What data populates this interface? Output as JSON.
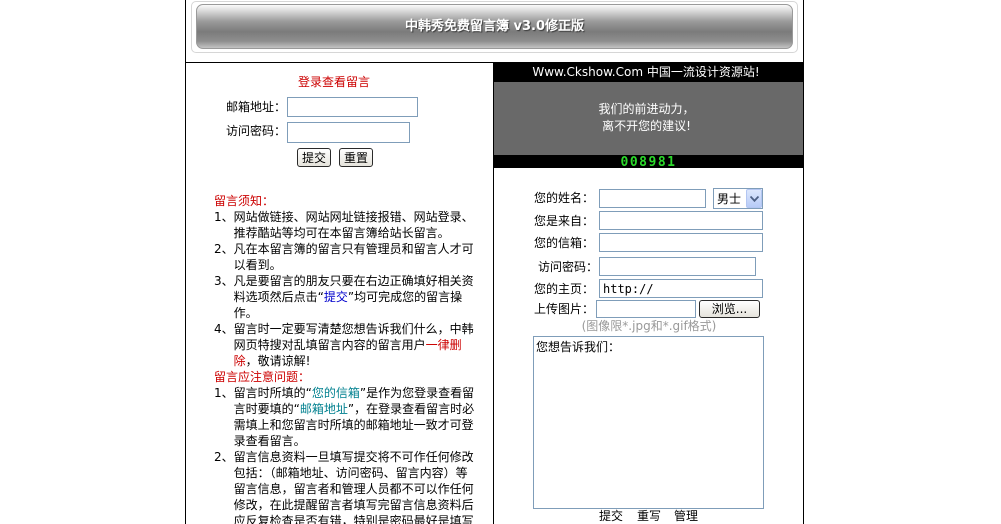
{
  "page": {
    "banner_title": "中韩秀免费留言簿 v3.0修正版"
  },
  "colors": {
    "red": "#cc0000",
    "blue": "#0000cc",
    "teal": "#00808f",
    "hint_gray": "#999999",
    "panel_gray": "#696969",
    "counter_green": "#2bd92b"
  },
  "login": {
    "heading": "登录查看留言",
    "email_label": "邮箱地址：",
    "email_value": "",
    "password_label": "访问密码：",
    "password_value": "",
    "submit_label": "提交",
    "reset_label": "重置"
  },
  "notice": {
    "heading": "留言须知：",
    "items": [
      {
        "num": "1、",
        "text": "网站做链接、网站网址链接报错、网站登录、推荐酷站等均可在本留言簿给站长留言。"
      },
      {
        "num": "2、",
        "text": "凡在本留言簿的留言只有管理员和留言人才可以看到。"
      },
      {
        "num": "3、",
        "text_before": "凡是要留言的朋友只要在右边正确填好相关资料选项然后点击“",
        "highlight": "提交",
        "text_after": "”均可完成您的留言操作。"
      },
      {
        "num": "4、",
        "text_before": "留言时一定要写清楚您想告诉我们什么，中韩网页特搜对乱填留言内容的留言用户",
        "highlight": "一律删除",
        "text_after": "，敬请谅解!"
      }
    ]
  },
  "attention": {
    "heading": "留言应注意问题：",
    "items": [
      {
        "num": "1、",
        "part1": "留言时所填的“",
        "highlight1": "您的信箱",
        "part2": "”是作为您登录查看留言时要填的“",
        "highlight2": "邮箱地址",
        "part3": "”，在登录查看留言时必需填上和您留言时所填的邮箱地址一致才可登录查看留言。"
      },
      {
        "num": "2、",
        "text": "留言信息资料一旦填写提交将不可作任何修改包括：（邮箱地址、访问密码、留言内容）等留言信息，留言者和管理人员都不可以作任何修改，在此提醒留言者填写完留言信息资料后应反复检查是否有错，特别是密码最好是填写"
      }
    ]
  },
  "site_bar": {
    "text": "Www.Ckshow.Com 中国一流设计资源站!"
  },
  "slogan": {
    "line1": "我们的前进动力，",
    "line2": "离不开您的建议!"
  },
  "counter": {
    "value": "008981"
  },
  "form": {
    "name_label": "您的姓名：",
    "name_value": "",
    "gender_selected": "男士",
    "from_label": "您是来自：",
    "from_value": "",
    "email_label": "您的信箱：",
    "email_value": "",
    "password_label": "访问密码：",
    "password_value": "",
    "homepage_label": "您的主页：",
    "homepage_value": "http://",
    "upload_label": "上传图片：",
    "upload_value": "",
    "browse_label": "浏览...",
    "upload_hint": "(图像限*.jpg和*.gif格式)",
    "message_value": "您想告诉我们："
  },
  "actions": [
    "提交",
    "重写",
    "管理"
  ]
}
